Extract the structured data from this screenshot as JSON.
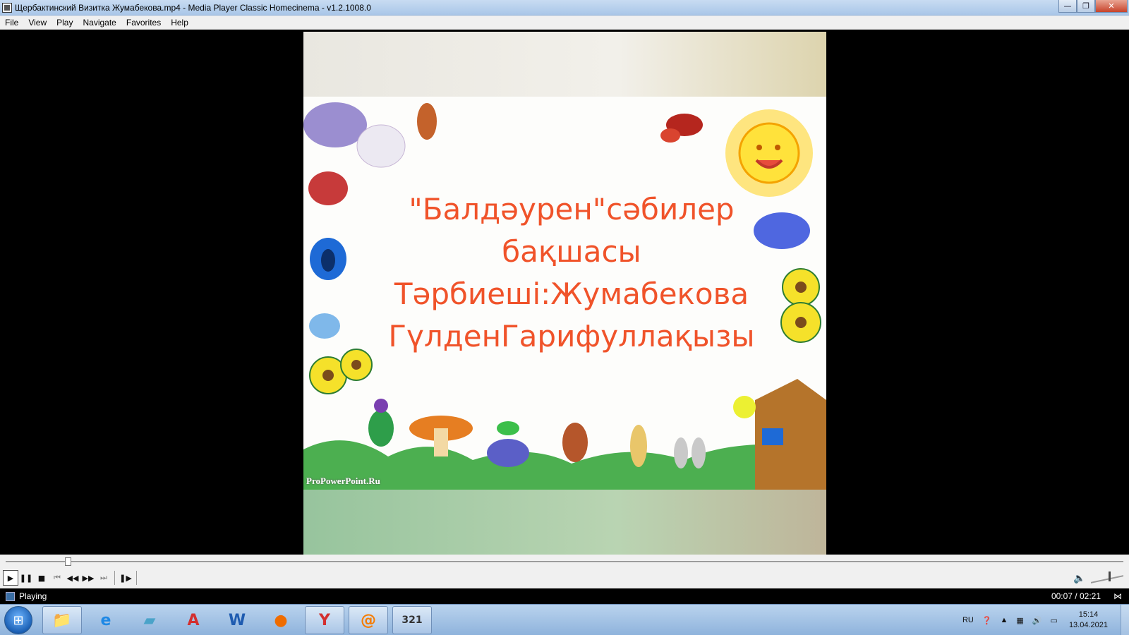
{
  "window": {
    "title": "Щербактинский Визитка Жумабекова.mp4 - Media Player Classic Homecinema - v1.2.1008.0",
    "minimize_label": "—",
    "maximize_label": "❐",
    "close_label": "✕"
  },
  "menu": [
    "File",
    "View",
    "Play",
    "Navigate",
    "Favorites",
    "Help"
  ],
  "video": {
    "lines": [
      "\"Балдәурен\"сәбилер",
      "бақшасы",
      "Тәрбиеші:Жумабекова",
      "ГүлденГарифуллақызы"
    ],
    "watermark": "ProPowerPoint.Ru"
  },
  "seek": {
    "position_fraction": 0.053
  },
  "volume": {
    "level_fraction": 0.55
  },
  "status": {
    "text": "Playing",
    "time": "00:07 / 02:21"
  },
  "taskbar": {
    "apps": [
      {
        "name": "explorer-icon",
        "glyph": "📁"
      },
      {
        "name": "internet-explorer-icon",
        "glyph": "e"
      },
      {
        "name": "notebook-icon",
        "glyph": "▰"
      },
      {
        "name": "pdf-reader-icon",
        "glyph": "A"
      },
      {
        "name": "word-icon",
        "glyph": "W"
      },
      {
        "name": "firefox-icon",
        "glyph": "●"
      },
      {
        "name": "yandex-icon",
        "glyph": "Y"
      },
      {
        "name": "mail-agent-icon",
        "glyph": "@"
      },
      {
        "name": "media-player-icon",
        "glyph": "321"
      }
    ],
    "language": "RU",
    "clock_time": "15:14",
    "clock_date": "13.04.2021"
  },
  "colors": {
    "slide_text": "#f0532a",
    "titlebar": "#a9c6e8",
    "taskbar": "#8fb3dc"
  }
}
